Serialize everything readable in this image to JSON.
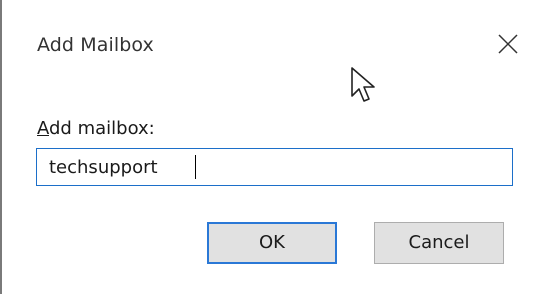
{
  "dialog": {
    "title": "Add Mailbox",
    "close_icon": "close-icon",
    "cursor_icon": "mouse-pointer-icon"
  },
  "form": {
    "label_accel": "A",
    "label_rest": "dd mailbox:",
    "value": "techsupport"
  },
  "buttons": {
    "ok": "OK",
    "cancel": "Cancel"
  },
  "colors": {
    "focus_border": "#1c6fc9",
    "default_button_border": "#2a78d6",
    "button_face": "#e1e1e1"
  }
}
